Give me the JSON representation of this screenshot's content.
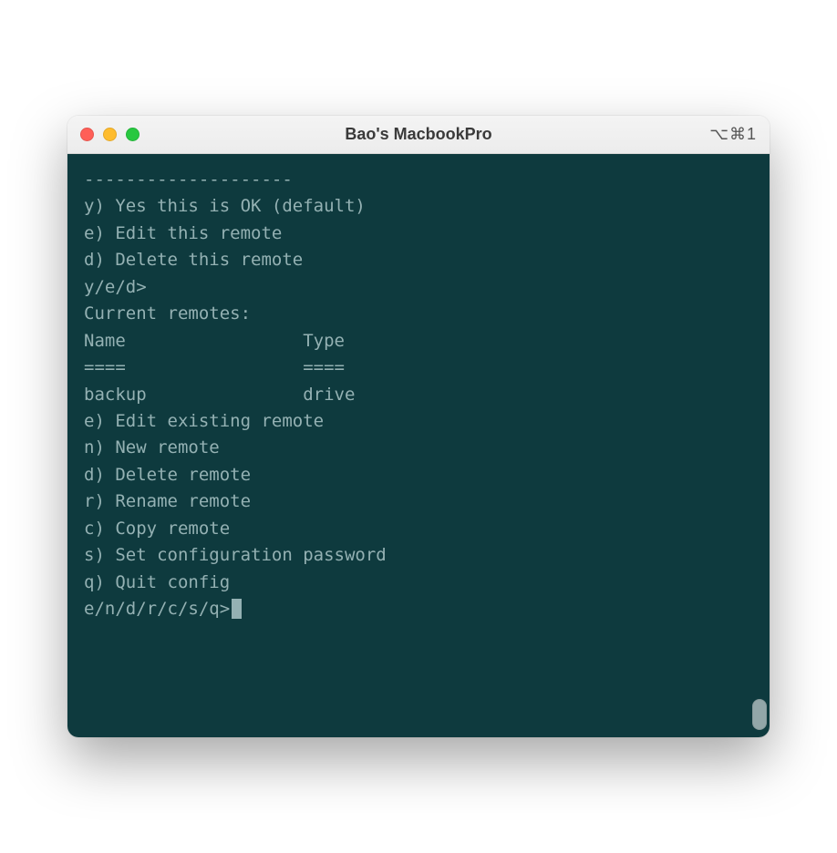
{
  "window": {
    "title": "Bao's MacbookPro",
    "shortcut": "⌥⌘1"
  },
  "terminal": {
    "divider": "--------------------",
    "confirm_options": {
      "y": "y) Yes this is OK (default)",
      "e": "e) Edit this remote",
      "d": "d) Delete this remote"
    },
    "confirm_prompt": "y/e/d>",
    "current_remotes_label": "Current remotes:",
    "blank": "",
    "table": {
      "header_name": "Name",
      "header_type": "Type",
      "underline_name": "====",
      "underline_type": "====",
      "row1_name": "backup",
      "row1_type": "drive",
      "header_line": "Name                 Type",
      "underline_line": "====                 ====",
      "row1_line": "backup               drive"
    },
    "menu": {
      "e": "e) Edit existing remote",
      "n": "n) New remote",
      "d": "d) Delete remote",
      "r": "r) Rename remote",
      "c": "c) Copy remote",
      "s": "s) Set configuration password",
      "q": "q) Quit config"
    },
    "main_prompt": "e/n/d/r/c/s/q>"
  }
}
